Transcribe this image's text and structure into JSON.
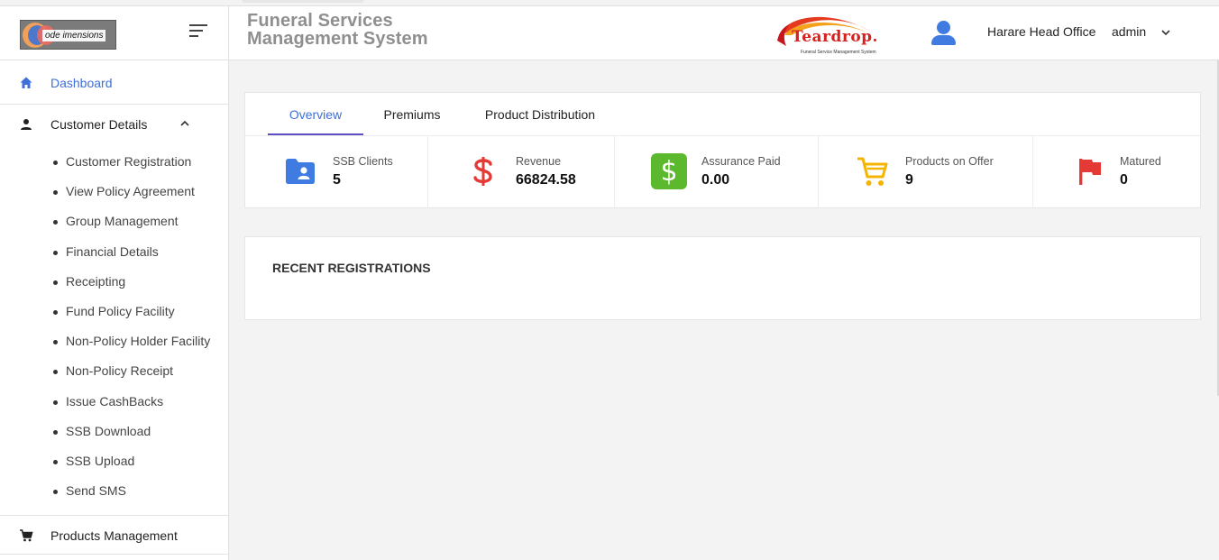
{
  "header": {
    "title_line1": "Funeral Services",
    "title_line2": "Management System",
    "brand_logo_text": "Teardrop.",
    "brand_logo_subtext": "Funeral Service Management System",
    "company_logo_text": "ode imensions",
    "office": "Harare Head Office",
    "user": "admin"
  },
  "sidebar": {
    "dashboard": "Dashboard",
    "customer_details": "Customer Details",
    "customer_items": [
      "Customer Registration",
      "View Policy Agreement",
      "Group Management",
      "Financial Details",
      "Receipting",
      "Fund Policy Facility",
      "Non-Policy Holder Facility",
      "Non-Policy Receipt",
      "Issue CashBacks",
      "SSB Download",
      "SSB Upload",
      "Send SMS"
    ],
    "products_management": "Products Management"
  },
  "tabs": [
    "Overview",
    "Premiums",
    "Product Distribution"
  ],
  "stats": [
    {
      "label": "SSB Clients",
      "value": "5",
      "icon": "folder-user-icon",
      "color": "#3f7be0"
    },
    {
      "label": "Revenue",
      "value": "66824.58",
      "icon": "dollar-icon",
      "color": "#e53935"
    },
    {
      "label": "Assurance Paid",
      "value": "0.00",
      "icon": "money-box-icon",
      "color": "#5cb82c"
    },
    {
      "label": "Products on Offer",
      "value": "9",
      "icon": "cart-icon",
      "color": "#f5b400"
    },
    {
      "label": "Matured",
      "value": "0",
      "icon": "flag-icon",
      "color": "#e53935"
    }
  ],
  "recent": {
    "title": "RECENT REGISTRATIONS"
  },
  "colors": {
    "accent": "#3f6fd8",
    "tab_indicator": "#5e4fc4"
  }
}
